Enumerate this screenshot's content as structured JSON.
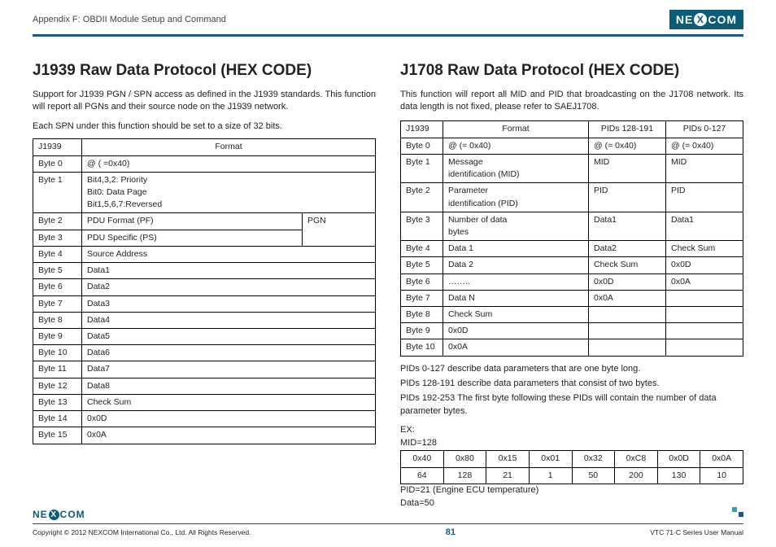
{
  "header": {
    "appendix": "Appendix F: OBDII Module Setup and Command",
    "brand_left": "NE",
    "brand_x": "X",
    "brand_right": "COM"
  },
  "left": {
    "title": "J1939 Raw Data Protocol (HEX CODE)",
    "intro": "Support for J1939 PGN / SPN access as defined in the J1939 standards. This function will report all PGNs and their source node on the J1939 network.",
    "note": "Each SPN under this function should be set to a size of 32 bits.",
    "table_hdr_c1": "J1939",
    "table_hdr_c2": "Format",
    "rows": {
      "b0_k": "Byte 0",
      "b0_v": "@ ( =0x40)",
      "b1_k": "Byte 1",
      "b1_v1": "Bit4,3,2: Priority",
      "b1_v2": "Bit0: Data Page",
      "b1_v3": "Bit1,5,6,7:Reversed",
      "b2_k": "Byte 2",
      "b2_v": "PDU Format (PF)",
      "b3_k": "Byte 3",
      "b3_v": "PDU Specific (PS)",
      "pgn": "PGN",
      "b4_k": "Byte 4",
      "b4_v": "Source Address",
      "b5_k": "Byte 5",
      "b5_v": "Data1",
      "b6_k": "Byte 6",
      "b6_v": "Data2",
      "b7_k": "Byte 7",
      "b7_v": "Data3",
      "b8_k": "Byte 8",
      "b8_v": "Data4",
      "b9_k": "Byte 9",
      "b9_v": "Data5",
      "b10_k": "Byte 10",
      "b10_v": "Data6",
      "b11_k": "Byte 11",
      "b11_v": "Data7",
      "b12_k": "Byte 12",
      "b12_v": "Data8",
      "b13_k": "Byte 13",
      "b13_v": "Check Sum",
      "b14_k": "Byte 14",
      "b14_v": "0x0D",
      "b15_k": "Byte 15",
      "b15_v": "0x0A"
    }
  },
  "right": {
    "title": "J1708 Raw Data Protocol (HEX CODE)",
    "intro": "This function will report all MID and PID that broadcasting on the J1708 network. Its data length is not fixed, please refer to SAEJ1708.",
    "hdr_c1": "J1939",
    "hdr_c2": "Format",
    "hdr_c3": "PIDs 128-191",
    "hdr_c4": "PIDs 0-127",
    "rows": {
      "b0_k": "Byte 0",
      "b0_c2": "@ (= 0x40)",
      "b0_c3": "@ (= 0x40)",
      "b0_c4": "@ (= 0x40)",
      "b1_k": "Byte 1",
      "b1_c2a": "Message",
      "b1_c2b": "identification (MID)",
      "b1_c3": "MID",
      "b1_c4": "MID",
      "b2_k": "Byte 2",
      "b2_c2a": "Parameter",
      "b2_c2b": "identification (PID)",
      "b2_c3": "PID",
      "b2_c4": "PID",
      "b3_k": "Byte 3",
      "b3_c2a": "Number of data",
      "b3_c2b": "bytes",
      "b3_c3": "Data1",
      "b3_c4": "Data1",
      "b4_k": "Byte 4",
      "b4_c2": "Data 1",
      "b4_c3": "Data2",
      "b4_c4": "Check Sum",
      "b5_k": "Byte 5",
      "b5_c2": "Data 2",
      "b5_c3": "Check Sum",
      "b5_c4": "0x0D",
      "b6_k": "Byte 6",
      "b6_c2": "……..",
      "b6_c3": "0x0D",
      "b6_c4": "0x0A",
      "b7_k": "Byte 7",
      "b7_c2": "Data N",
      "b7_c3": "0x0A",
      "b7_c4": "",
      "b8_k": "Byte 8",
      "b8_c2": "Check Sum",
      "b8_c3": "",
      "b8_c4": "",
      "b9_k": "Byte 9",
      "b9_c2": "0x0D",
      "b9_c3": "",
      "b9_c4": "",
      "b10_k": "Byte 10",
      "b10_c2": "0x0A",
      "b10_c3": "",
      "b10_c4": ""
    },
    "post": {
      "p1": "PIDs 0-127 describe data parameters that are one byte long.",
      "p2": "PIDs 128-191 describe data parameters that consist of two bytes.",
      "p3": "PIDs 192-253 The first byte following these PIDs will contain the number of data parameter bytes."
    },
    "ex_label": "EX:",
    "mid_label": "MID=128",
    "ex_row1": [
      "0x40",
      "0x80",
      "0x15",
      "0x01",
      "0x32",
      "0xC8",
      "0x0D",
      "0x0A"
    ],
    "ex_row2": [
      "64",
      "128",
      "21",
      "1",
      "50",
      "200",
      "130",
      "10"
    ],
    "pid_label": "PID=21 (Engine ECU temperature)",
    "data_label": "Data=50"
  },
  "footer": {
    "copyright": "Copyright © 2012 NEXCOM International Co., Ltd. All Rights Reserved.",
    "page": "81",
    "manual": "VTC 71-C Series User Manual"
  }
}
